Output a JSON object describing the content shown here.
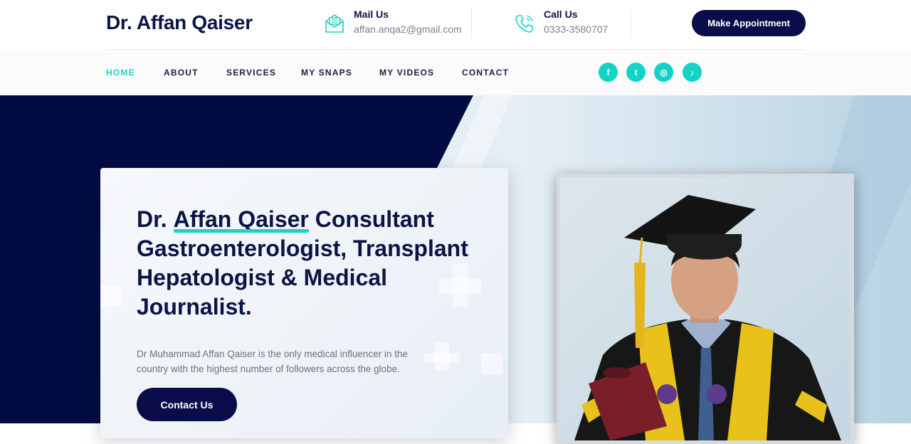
{
  "header": {
    "logo": "Dr. Affan Qaiser",
    "mail": {
      "label": "Mail Us",
      "value": "affan.anqa2@gmail.com",
      "icon": "mail-icon"
    },
    "call": {
      "label": "Call Us",
      "value": "0333-3580707",
      "icon": "phone-icon"
    },
    "appointment_button": "Make Appointment"
  },
  "nav": {
    "items": [
      {
        "label": "HOME",
        "active": true
      },
      {
        "label": "ABOUT",
        "active": false
      },
      {
        "label": "SERVICES",
        "active": false
      },
      {
        "label": "MY SNAPS",
        "active": false
      },
      {
        "label": "MY VIDEOS",
        "active": false
      },
      {
        "label": "CONTACT",
        "active": false
      }
    ],
    "social": [
      {
        "name": "facebook-icon",
        "glyph": "f"
      },
      {
        "name": "twitter-icon",
        "glyph": "t"
      },
      {
        "name": "instagram-icon",
        "glyph": "◎"
      },
      {
        "name": "tiktok-icon",
        "glyph": "♪"
      }
    ]
  },
  "hero": {
    "title_prefix": "Dr. ",
    "title_highlight": "Affan Qaiser",
    "title_rest": " Consultant Gastroenterologist, Transplant Hepatologist & Medical Journalist.",
    "description": "Dr Muhammad Affan Qaiser is the only medical influencer in the country with the highest number of followers across the globe.",
    "cta_button": "Contact Us"
  },
  "colors": {
    "navy": "#0b1445",
    "accent": "#19d3c5",
    "button": "#0b0c4a"
  }
}
